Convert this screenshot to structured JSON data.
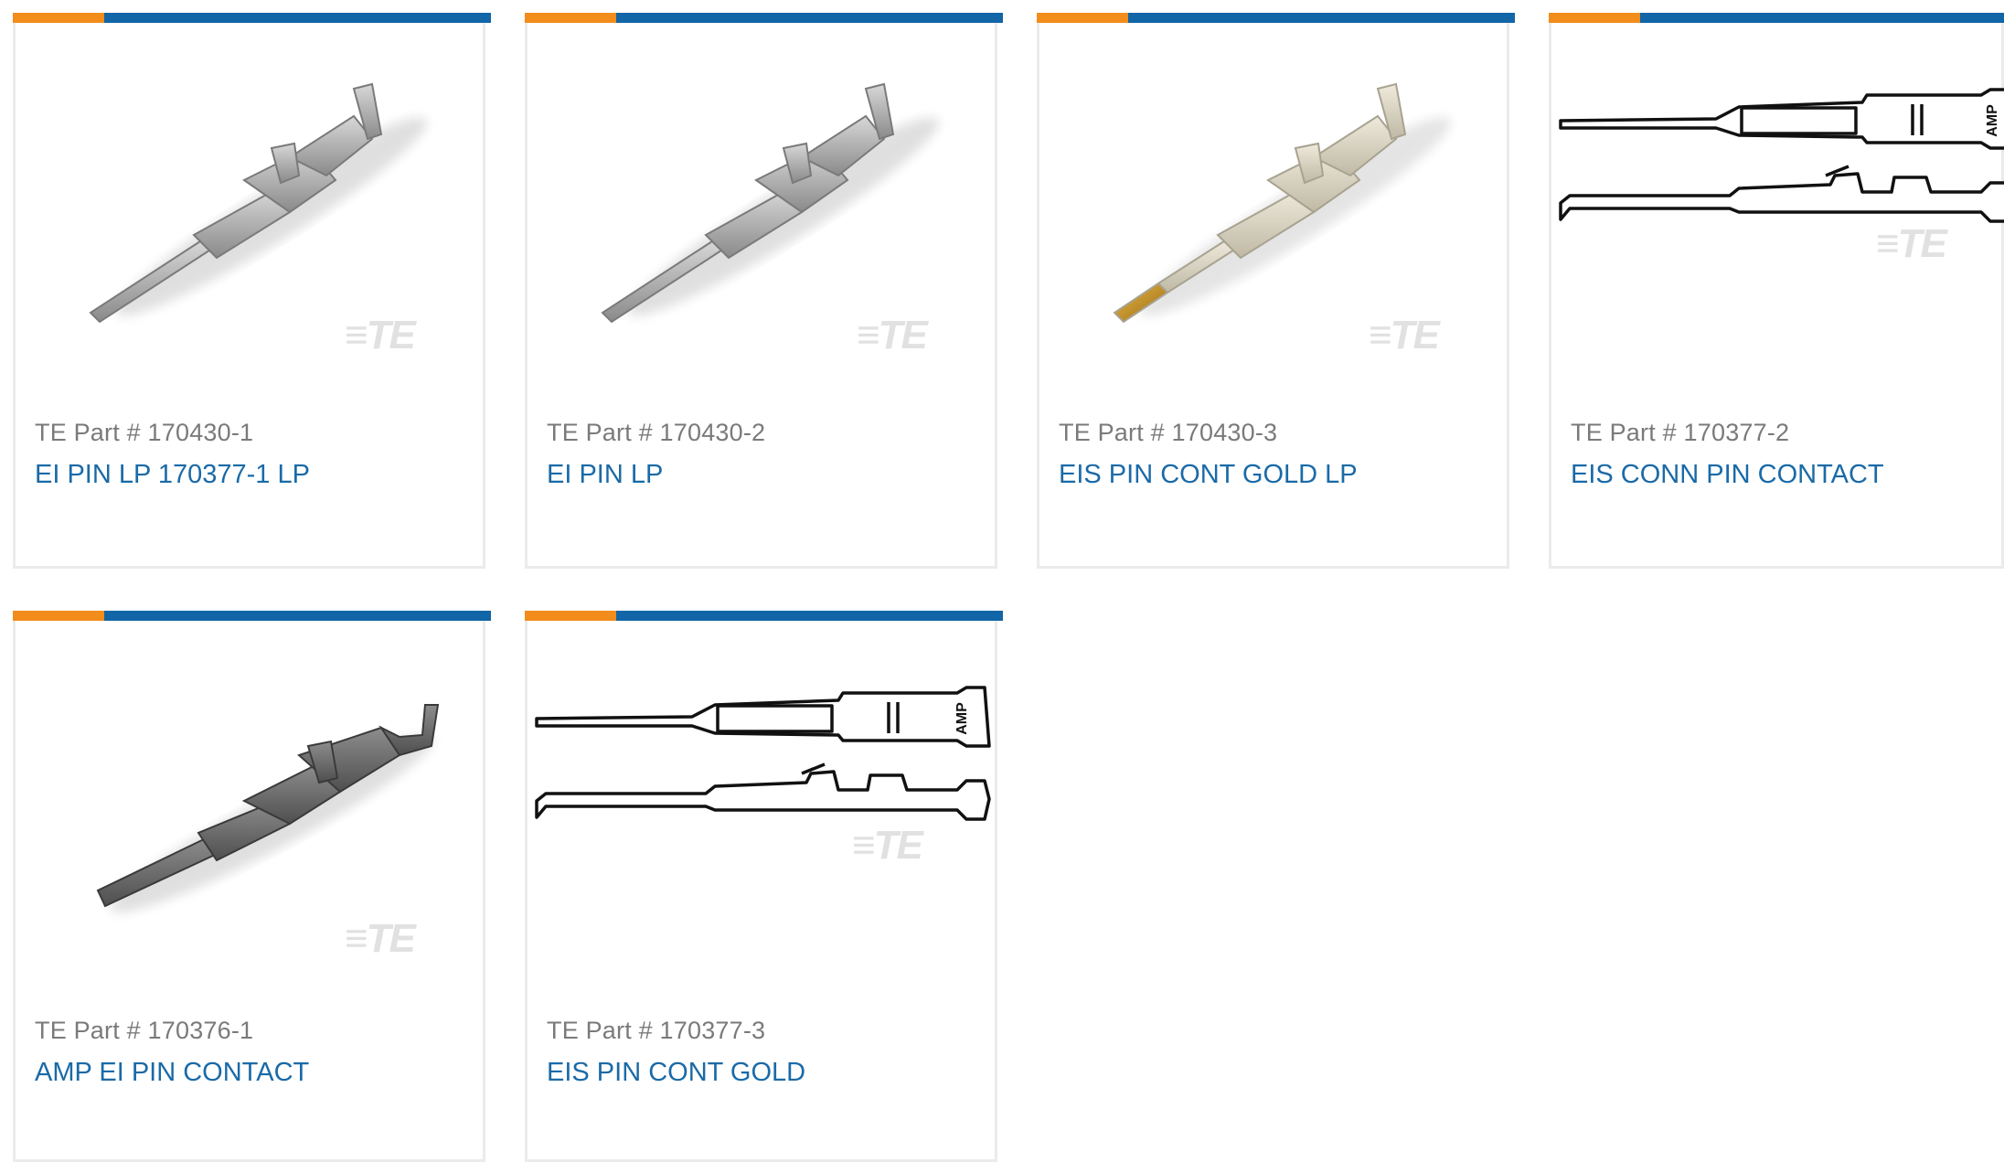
{
  "products": [
    {
      "part_label": "TE Part # 170430-1",
      "title": "EI PIN LP 170377-1 LP",
      "image": "pin-contact-silver-render",
      "watermark": "TE"
    },
    {
      "part_label": "TE Part # 170430-2",
      "title": "EI PIN LP",
      "image": "pin-contact-silver-render",
      "watermark": "TE"
    },
    {
      "part_label": "TE Part # 170430-3",
      "title": "EIS PIN CONT GOLD LP",
      "image": "pin-contact-gold-tip-render",
      "watermark": "TE"
    },
    {
      "part_label": "TE Part # 170377-2",
      "title": "EIS CONN PIN CONTACT",
      "image": "pin-contact-line-drawing",
      "watermark": "TE",
      "drawing_label": "AMP"
    },
    {
      "part_label": "TE Part # 170376-1",
      "title": "AMP EI PIN CONTACT",
      "image": "pin-contact-dark-render",
      "watermark": "TE"
    },
    {
      "part_label": "TE Part # 170377-3",
      "title": "EIS PIN CONT GOLD",
      "image": "pin-contact-line-drawing",
      "watermark": "TE",
      "drawing_label": "AMP"
    }
  ],
  "colors": {
    "accent_orange": "#f28c1b",
    "accent_blue": "#1265a6",
    "link_blue": "#1a6aa7",
    "part_gray": "#7a7a7a",
    "border_gray": "#ebebeb"
  }
}
